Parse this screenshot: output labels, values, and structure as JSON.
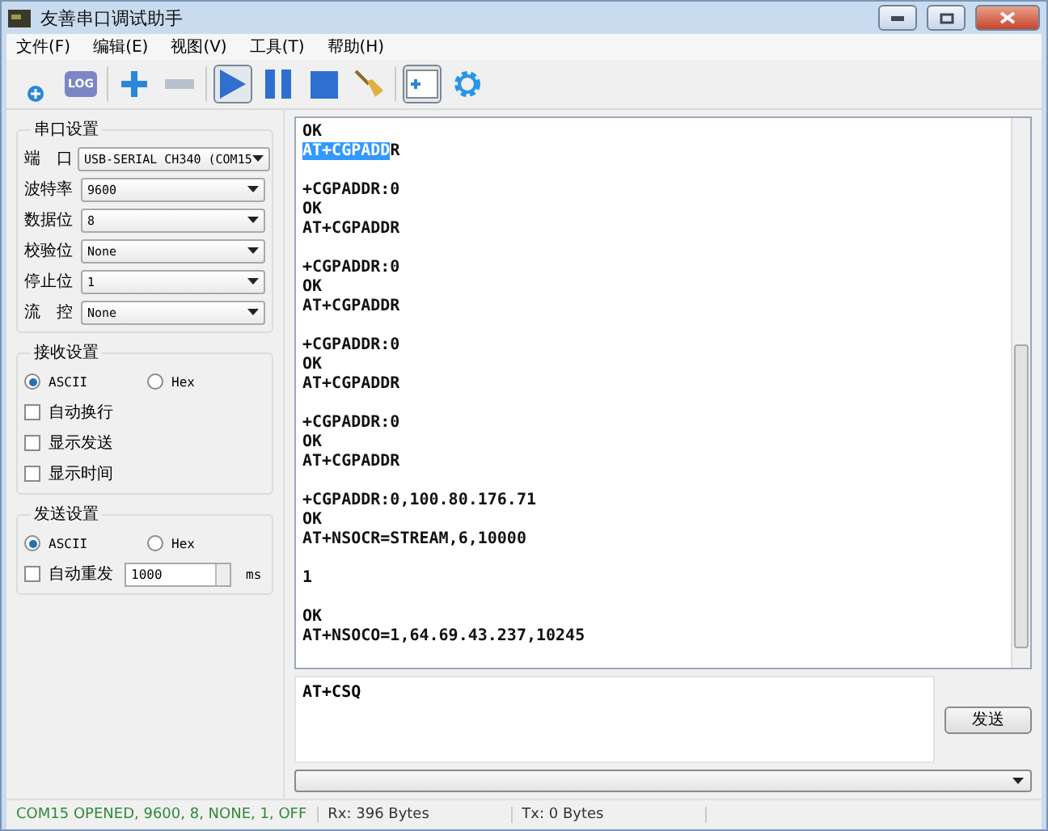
{
  "window": {
    "title": "友善串口调试助手"
  },
  "menu": [
    "文件(F)",
    "编辑(E)",
    "视图(V)",
    "工具(T)",
    "帮助(H)"
  ],
  "toolbar": [
    {
      "kind": "add-dot"
    },
    {
      "kind": "log",
      "label": "LOG"
    },
    {
      "kind": "sep"
    },
    {
      "kind": "plus"
    },
    {
      "kind": "minus"
    },
    {
      "kind": "sep"
    },
    {
      "kind": "play",
      "pressed": true
    },
    {
      "kind": "pause",
      "pressed": false
    },
    {
      "kind": "stop",
      "pressed": false
    },
    {
      "kind": "broom",
      "pressed": false
    },
    {
      "kind": "sep"
    },
    {
      "kind": "panel",
      "pressed": true
    },
    {
      "kind": "gear",
      "pressed": false
    }
  ],
  "serial_settings": {
    "title": "串口设置",
    "fields": [
      {
        "label": "端　口",
        "value": "USB-SERIAL CH340 (COM15"
      },
      {
        "label": "波特率",
        "value": "9600"
      },
      {
        "label": "数据位",
        "value": "8"
      },
      {
        "label": "校验位",
        "value": "None"
      },
      {
        "label": "停止位",
        "value": "1"
      },
      {
        "label": "流　控",
        "value": "None"
      }
    ]
  },
  "receive_settings": {
    "title": "接收设置",
    "modes": [
      {
        "label": "ASCII",
        "selected": true
      },
      {
        "label": "Hex",
        "selected": false
      }
    ],
    "options": [
      {
        "label": "自动换行",
        "checked": false
      },
      {
        "label": "显示发送",
        "checked": false
      },
      {
        "label": "显示时间",
        "checked": false
      }
    ]
  },
  "send_settings": {
    "title": "发送设置",
    "modes": [
      {
        "label": "ASCII",
        "selected": true
      },
      {
        "label": "Hex",
        "selected": false
      }
    ],
    "auto_resend": {
      "label": "自动重发",
      "checked": false,
      "interval": "1000",
      "unit": "ms"
    }
  },
  "log_blocks": [
    {
      "lines": [
        {
          "text": "OK"
        },
        {
          "selected": "AT+CGPADD",
          "text": "R"
        }
      ]
    },
    {
      "lines": [
        {
          "text": "+CGPADDR:0"
        },
        {
          "text": "OK"
        },
        {
          "text": "AT+CGPADDR"
        }
      ]
    },
    {
      "lines": [
        {
          "text": "+CGPADDR:0"
        },
        {
          "text": "OK"
        },
        {
          "text": "AT+CGPADDR"
        }
      ]
    },
    {
      "lines": [
        {
          "text": "+CGPADDR:0"
        },
        {
          "text": "OK"
        },
        {
          "text": "AT+CGPADDR"
        }
      ]
    },
    {
      "lines": [
        {
          "text": "+CGPADDR:0"
        },
        {
          "text": "OK"
        },
        {
          "text": "AT+CGPADDR"
        }
      ]
    },
    {
      "lines": [
        {
          "text": "+CGPADDR:0,100.80.176.71"
        },
        {
          "text": "OK"
        },
        {
          "text": "AT+NSOCR=STREAM,6,10000"
        }
      ]
    },
    {
      "lines": [
        {
          "text": "1"
        }
      ]
    },
    {
      "lines": [
        {
          "text": "OK"
        },
        {
          "text": "AT+NSOCO=1,64.69.43.237,10245"
        }
      ]
    }
  ],
  "send_input": {
    "value": "AT+CSQ"
  },
  "send_button": "发送",
  "status_bar": [
    "COM15 OPENED, 9600, 8, NONE, 1, OFF",
    "Rx: 396 Bytes",
    "Tx: 0 Bytes"
  ]
}
